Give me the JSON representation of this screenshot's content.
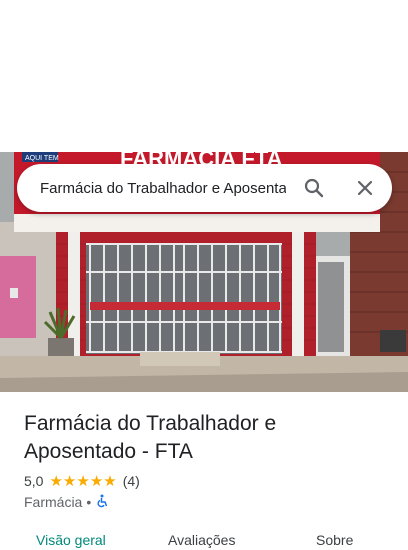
{
  "search": {
    "query": "Farmácia do Trabalhador e Aposentado - FTA"
  },
  "storefront": {
    "sign_text": "FARMÁCIA FTA",
    "small_sign": "AQUI TEM"
  },
  "place": {
    "title_line1": "Farmácia do Trabalhador e",
    "title_line2": "Aposentado - FTA",
    "rating_value": "5,0",
    "stars": 5,
    "review_count": "(4)",
    "category": "Farmácia",
    "separator": "•"
  },
  "tabs": [
    {
      "label": "Visão geral",
      "active": true
    },
    {
      "label": "Avaliações",
      "active": false
    },
    {
      "label": "Sobre",
      "active": false
    }
  ],
  "colors": {
    "accent": "#00897b",
    "star": "#f9ab00",
    "accessible_icon": "#1a73e8"
  },
  "icons": {
    "search": "search-icon",
    "close": "close-icon",
    "accessibility": "wheelchair-icon",
    "star": "star-icon"
  }
}
